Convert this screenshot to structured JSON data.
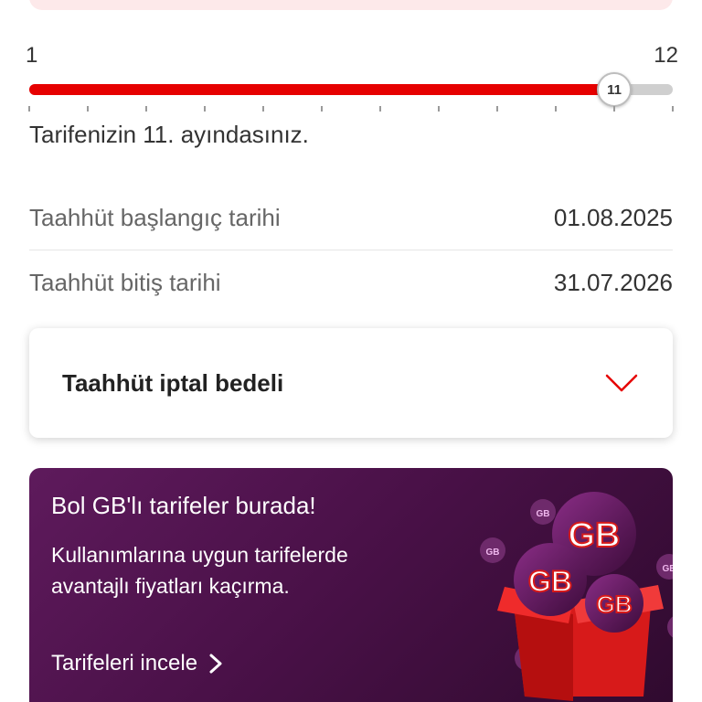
{
  "slider": {
    "min_label": "1",
    "max_label": "12",
    "current": 11,
    "thumb_label": "11",
    "min": 1,
    "max": 12,
    "fill_color": "#e60000"
  },
  "month_text": "Tarifenizin 11. ayındasınız.",
  "commitment": {
    "start_label": "Taahhüt başlangıç tarihi",
    "start_value": "01.08.2025",
    "end_label": "Taahhüt bitiş tarihi",
    "end_value": "31.07.2026"
  },
  "accordion": {
    "title": "Taahhüt iptal bedeli",
    "icon": "chevron-down-icon"
  },
  "promo": {
    "title": "Bol GB'lı tarifeler burada!",
    "description": "Kullanımlarına uygun tarifelerde avantajlı fiyatları kaçırma.",
    "link_label": "Tarifeleri incele",
    "badge_text": "GB",
    "icon": "gift-box-gb-illustration"
  },
  "colors": {
    "accent": "#e60000",
    "promo_bg": "#4a1148"
  }
}
